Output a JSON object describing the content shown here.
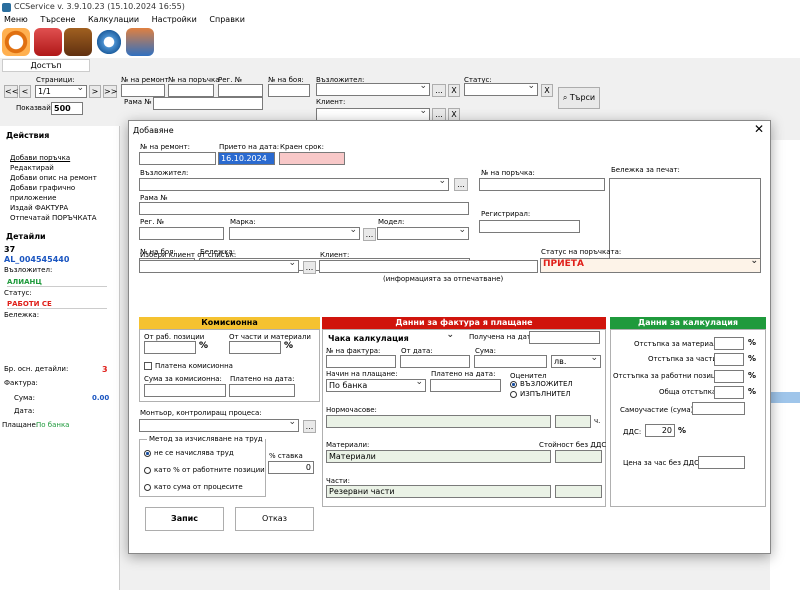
{
  "app": {
    "title": "CCService v. 3.9.10.23 (15.10.2024 16:55)"
  },
  "menu": [
    "Меню",
    "Търсене",
    "Калкулации",
    "Настройки",
    "Справки"
  ],
  "toolbar": {
    "access_label": "Достъп"
  },
  "filters": {
    "pages_label": "Страници:",
    "page_value": "1/1",
    "nav_first": "<<",
    "nav_prev": "<",
    "nav_next": ">",
    "nav_last": ">>",
    "show_label": "Показвай",
    "show_value": "500",
    "repair_no_label": "№ на ремонт",
    "order_no_label": "№ на поръчка",
    "reg_no_label": "Рег. №",
    "frame_label": "Рама №",
    "paint_no_label": "№ на боя:",
    "assignor_label": "Възложител:",
    "client_label": "Клиент:",
    "status_label": "Статус:",
    "search_button": "Търси",
    "ellipsis": "...",
    "x": "X"
  },
  "left_panel": {
    "actions_title": "Действия",
    "actions": [
      "Добави поръчка",
      "Редактирай",
      "Добави опис на ремонт",
      "Добави графично приложение",
      "Издай ФАКТУРА",
      "Отпечатай ПОРЪЧКАТА"
    ],
    "details_title": "Детайли",
    "detail_number": "37",
    "detail_code": "AL_004545440",
    "assignor_label": "Възложител:",
    "assignor_value": "АЛИАНЦ",
    "status_label": "Статус:",
    "status_value": "РАБОТИ СЕ",
    "note_label": "Бележка:",
    "main_details_label": "Бр. осн. детайли:",
    "main_details_value": "3",
    "invoice_label": "Фактура:",
    "sum_label": "Сума:",
    "sum_value": "0.00",
    "date_label": "Дата:",
    "payment_label": "Плащане:",
    "payment_value": "По банка"
  },
  "dialog": {
    "title": "Добавяне",
    "repair_no_label": "№ на ремонт:",
    "accepted_date_label": "Прието на дата:",
    "accepted_date_value": "16.10.2024",
    "deadline_label": "Краен срок:",
    "assignor_label": "Възложител:",
    "order_no_label": "№ на поръчка:",
    "note_print_label": "Бележка за печат:",
    "frame_label": "Рама №",
    "reg_label": "Рег. №",
    "make_label": "Марка:",
    "model_label": "Модел:",
    "registered_label": "Регистрирал:",
    "paint_label": "№ на боя:",
    "note_label": "Бележка:",
    "choose_client_label": "Избери клиент от списък:",
    "client_label": "Клиент:",
    "client_hint": "(информацията за отпечатване)",
    "order_status_label": "Статус на поръчката:",
    "order_status_value": "ПРИЕТА",
    "commission": {
      "header": "Комисионна",
      "work_pct_label": "От раб. позиции",
      "parts_pct_label": "От части и материали",
      "pct": "%",
      "paid_label": "Платена комисионна",
      "sum_label": "Сума за комисионна:",
      "paid_date_label": "Платено на дата:"
    },
    "invoice": {
      "header": "Данни за фактура я плащане",
      "calc_value": "Чака калкулация",
      "received_date_label": "Получена на дата:",
      "invoice_no_label": "№ на фактура:",
      "from_date_label": "От дата:",
      "sum_label": "Сума:",
      "currency": "лв.",
      "payment_method_label": "Начин на плащане:",
      "payment_method_value": "По банка",
      "paid_date_label": "Платено на дата:",
      "evaluator_label": "Оценител",
      "evaluator_opt1": "ВЪЗЛОЖИТЕЛ",
      "evaluator_opt2": "ИЗПЪЛНИТЕЛ",
      "labor_hours_label": "Нормочасове:",
      "hours_unit": "ч.",
      "materials_label": "Материали:",
      "value_no_vat_label": "Стойност без ДДС",
      "materials_value": "Материали",
      "parts_label": "Части:",
      "parts_value": "Резервни части"
    },
    "calc": {
      "header": "Данни за калкулация",
      "disc_materials": "Отстъпка за материали:",
      "disc_parts": "Отстъпка за части:",
      "disc_work": "Отстъпка за работни позиции:",
      "disc_total": "Обща отстъпка:",
      "pct": "%",
      "self_part_label": "Самоучастие (сума):",
      "vat_label": "ДДС:",
      "vat_value": "20",
      "hour_price_label": "Цена за час без ДДС:"
    },
    "mechanic_label": "Монтьор, контролиращ процеса:",
    "method": {
      "title": "Метод за изчисляване на труд",
      "opt1": "не се начислява труд",
      "opt2": "като % от работните позиции",
      "opt3": "като сума от процесите",
      "rate_label": "% ставка",
      "rate_value": "0"
    },
    "save_button": "Запис",
    "cancel_button": "Отказ"
  },
  "colors": {
    "commission": "#f5c230",
    "invoice": "#d0140c",
    "calc": "#1f9a3c",
    "status_text": "#e0201a",
    "link": "#1a55c0"
  }
}
